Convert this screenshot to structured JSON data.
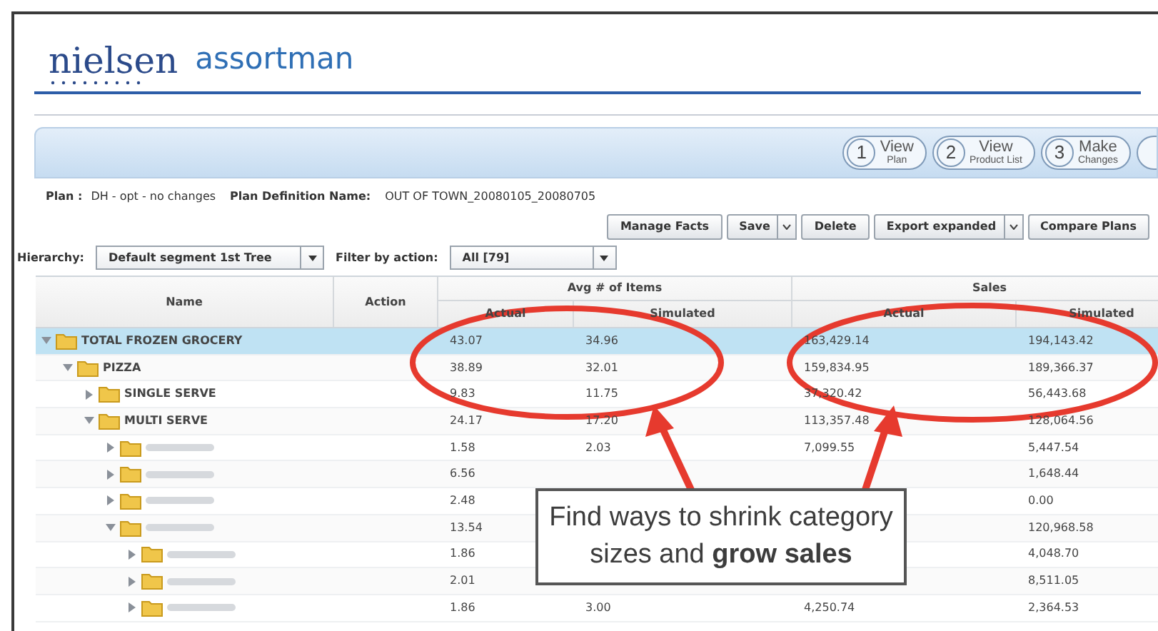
{
  "logo": {
    "brand": "nielsen",
    "product": "assortman"
  },
  "steps": [
    {
      "number": "1",
      "title": "View",
      "subtitle": "Plan"
    },
    {
      "number": "2",
      "title": "View",
      "subtitle": "Product List"
    },
    {
      "number": "3",
      "title": "Make",
      "subtitle": "Changes"
    }
  ],
  "plan": {
    "label": "Plan :",
    "value": "DH - opt - no changes",
    "definition_label": "Plan Definition Name:",
    "definition_value": "OUT OF TOWN_20080105_20080705"
  },
  "toolbar": [
    {
      "label": "Manage Facts",
      "dropdown": false
    },
    {
      "label": "Save",
      "dropdown": true
    },
    {
      "label": "Delete",
      "dropdown": false
    },
    {
      "label": "Export expanded",
      "dropdown": true
    },
    {
      "label": "Compare Plans",
      "dropdown": false
    }
  ],
  "filters": [
    {
      "label": "Hierarchy:",
      "value": "Default segment 1st Tree"
    },
    {
      "label": "Filter by action:",
      "value": "All [79]"
    }
  ],
  "table": {
    "columns": [
      "Name",
      "Action"
    ],
    "groups": [
      {
        "label": "Avg # of Items",
        "columns": [
          "Actual",
          "Simulated"
        ]
      },
      {
        "label": "Sales",
        "columns": [
          "Actual",
          "Simulated"
        ]
      }
    ],
    "rows": [
      {
        "name": "TOTAL FROZEN GROCERY",
        "expanded": true,
        "selected": true,
        "cells": [
          "43.07",
          "34.96",
          "163,429.14",
          "194,143.42"
        ],
        "children": [
          {
            "name": "PIZZA",
            "expanded": true,
            "selected": false,
            "cells": [
              "38.89",
              "32.01",
              "159,834.95",
              "189,366.37"
            ],
            "children": [
              {
                "name": "SINGLE SERVE",
                "expanded": false,
                "selected": false,
                "cells": [
                  "9.83",
                  "11.75",
                  "37,320.42",
                  "56,443.68"
                ]
              },
              {
                "name": "MULTI SERVE",
                "expanded": true,
                "selected": false,
                "cells": [
                  "24.17",
                  "17.20",
                  "113,357.48",
                  "128,064.56"
                ],
                "children": [
                  {
                    "expanded": false,
                    "selected": false,
                    "cells": [
                      "1.58",
                      "2.03",
                      "7,099.55",
                      "5,447.54"
                    ]
                  },
                  {
                    "expanded": false,
                    "selected": false,
                    "cells": [
                      "6.56",
                      null,
                      null,
                      "1,648.44"
                    ]
                  },
                  {
                    "expanded": false,
                    "selected": false,
                    "cells": [
                      "2.48",
                      null,
                      null,
                      "0.00"
                    ]
                  },
                  {
                    "expanded": true,
                    "selected": false,
                    "cells": [
                      "13.54",
                      null,
                      null,
                      "120,968.58"
                    ],
                    "children": [
                      {
                        "expanded": false,
                        "selected": false,
                        "cells": [
                          "1.86",
                          null,
                          null,
                          "4,048.70"
                        ]
                      },
                      {
                        "expanded": false,
                        "selected": false,
                        "cells": [
                          "2.01",
                          null,
                          null,
                          "8,511.05"
                        ]
                      },
                      {
                        "expanded": false,
                        "selected": false,
                        "cells": [
                          "1.86",
                          "3.00",
                          "4,250.74",
                          "2,364.53"
                        ]
                      }
                    ]
                  }
                ]
              }
            ]
          }
        ]
      }
    ]
  },
  "callout": {
    "text": "Find ways to shrink category sizes and **grow sales**"
  }
}
